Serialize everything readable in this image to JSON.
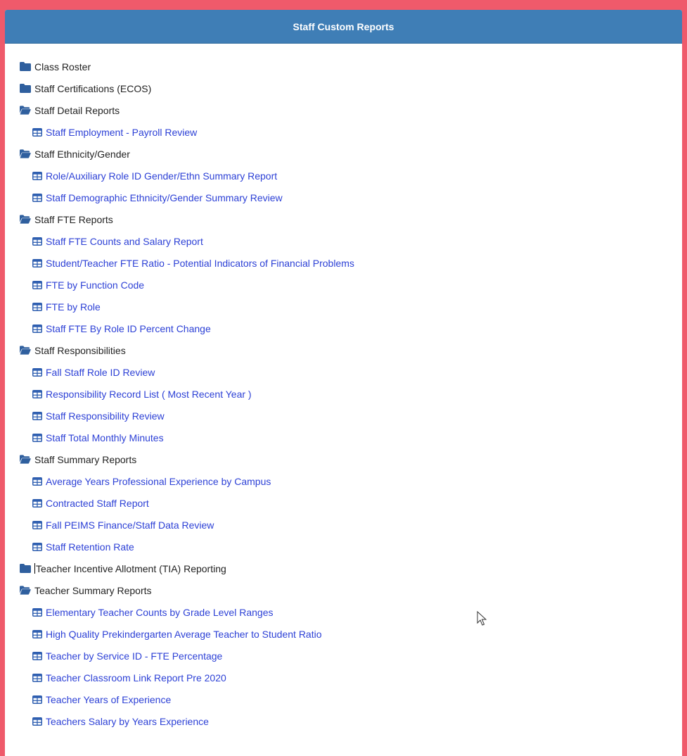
{
  "colors": {
    "accent": "#3f7eb6",
    "link": "#2d41d6",
    "folder_icon": "#2f5f9e",
    "frame": "#ef5a6b"
  },
  "panel": {
    "title": "Staff Custom Reports"
  },
  "tree": [
    {
      "type": "folder",
      "state": "closed",
      "label": "Class Roster",
      "icon": "folder-icon"
    },
    {
      "type": "folder",
      "state": "closed",
      "label": "Staff Certifications (ECOS)",
      "icon": "folder-icon"
    },
    {
      "type": "folder",
      "state": "open",
      "label": "Staff Detail Reports",
      "icon": "folder-open-icon"
    },
    {
      "type": "report",
      "label": "Staff Employment - Payroll Review",
      "icon": "table-icon"
    },
    {
      "type": "folder",
      "state": "open",
      "label": "Staff Ethnicity/Gender",
      "icon": "folder-open-icon"
    },
    {
      "type": "report",
      "label": "Role/Auxiliary Role ID Gender/Ethn Summary Report",
      "icon": "table-icon"
    },
    {
      "type": "report",
      "label": "Staff Demographic Ethnicity/Gender Summary Review",
      "icon": "table-icon"
    },
    {
      "type": "folder",
      "state": "open",
      "label": "Staff FTE Reports",
      "icon": "folder-open-icon"
    },
    {
      "type": "report",
      "label": "Staff FTE Counts and Salary Report",
      "icon": "table-icon"
    },
    {
      "type": "report",
      "label": "Student/Teacher FTE Ratio - Potential Indicators of Financial Problems",
      "icon": "table-icon"
    },
    {
      "type": "report",
      "label": "FTE by Function Code",
      "icon": "table-icon"
    },
    {
      "type": "report",
      "label": "FTE by Role",
      "icon": "table-icon"
    },
    {
      "type": "report",
      "label": "Staff FTE By Role ID Percent Change",
      "icon": "table-icon"
    },
    {
      "type": "folder",
      "state": "open",
      "label": "Staff Responsibilities",
      "icon": "folder-open-icon"
    },
    {
      "type": "report",
      "label": "Fall Staff Role ID Review",
      "icon": "table-icon"
    },
    {
      "type": "report",
      "label": "Responsibility Record List ( Most Recent Year )",
      "icon": "table-icon"
    },
    {
      "type": "report",
      "label": "Staff Responsibility Review",
      "icon": "table-icon"
    },
    {
      "type": "report",
      "label": "Staff Total Monthly Minutes",
      "icon": "table-icon"
    },
    {
      "type": "folder",
      "state": "open",
      "label": "Staff Summary Reports",
      "icon": "folder-open-icon"
    },
    {
      "type": "report",
      "label": "Average Years Professional Experience by Campus",
      "icon": "table-icon"
    },
    {
      "type": "report",
      "label": "Contracted Staff Report",
      "icon": "table-icon"
    },
    {
      "type": "report",
      "label": "Fall PEIMS Finance/Staff Data Review",
      "icon": "table-icon"
    },
    {
      "type": "report",
      "label": "Staff Retention Rate",
      "icon": "table-icon"
    },
    {
      "type": "folder",
      "state": "closed",
      "label": "Teacher Incentive Allotment (TIA) Reporting",
      "icon": "folder-icon"
    },
    {
      "type": "folder",
      "state": "open",
      "label": "Teacher Summary Reports",
      "icon": "folder-open-icon"
    },
    {
      "type": "report",
      "label": "Elementary Teacher Counts by Grade Level Ranges",
      "icon": "table-icon"
    },
    {
      "type": "report",
      "label": "High Quality Prekindergarten Average Teacher to Student Ratio",
      "icon": "table-icon"
    },
    {
      "type": "report",
      "label": "Teacher by Service ID - FTE Percentage",
      "icon": "table-icon"
    },
    {
      "type": "report",
      "label": "Teacher Classroom Link Report Pre 2020",
      "icon": "table-icon"
    },
    {
      "type": "report",
      "label": "Teacher Years of Experience",
      "icon": "table-icon"
    },
    {
      "type": "report",
      "label": "Teachers Salary by Years Experience",
      "icon": "table-icon"
    }
  ]
}
